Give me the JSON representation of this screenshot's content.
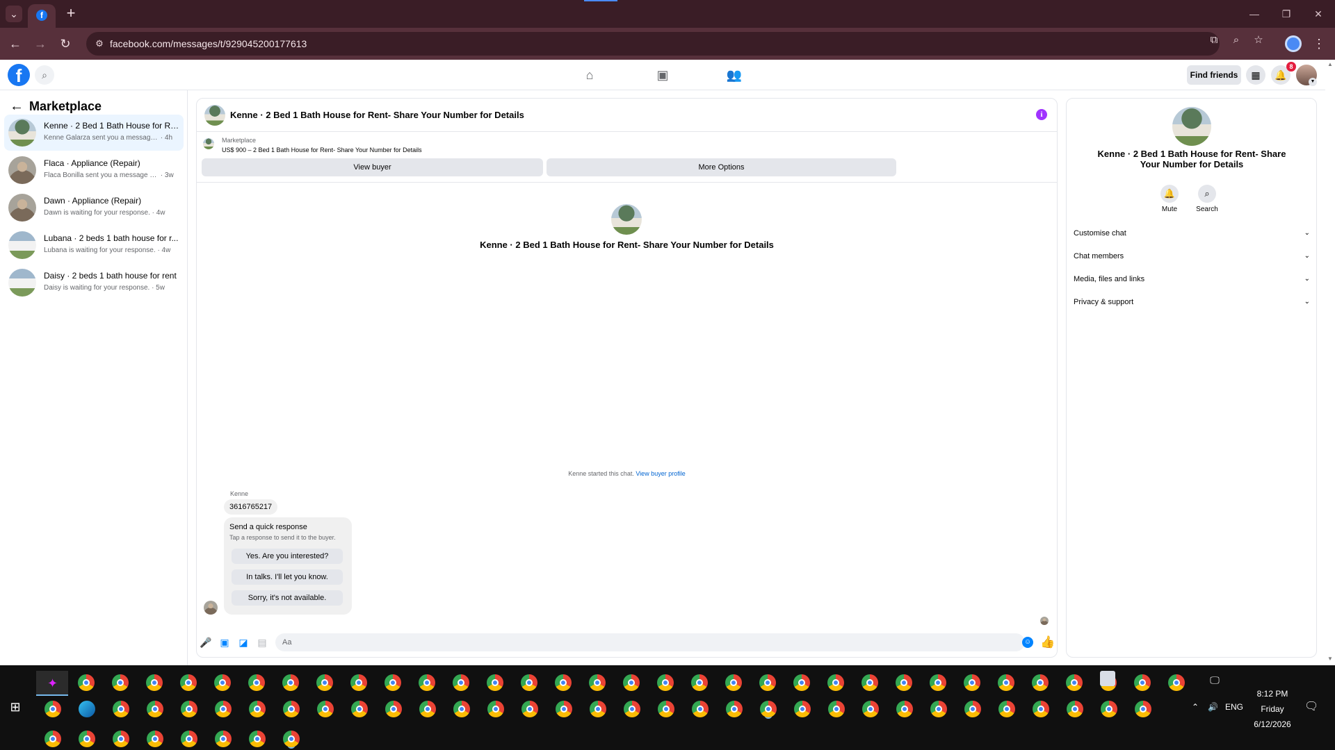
{
  "browser": {
    "url": "facebook.com/messages/t/929045200177613",
    "window_controls": {
      "minimize": "—",
      "restore": "❐",
      "close": "✕"
    }
  },
  "fb_header": {
    "logo": "f",
    "find_friends_label": "Find friends",
    "notification_count": "8"
  },
  "sidebar": {
    "title": "Marketplace",
    "conversations": [
      {
        "name": "Kenne · 2 Bed 1 Bath House for Re...",
        "preview": "Kenne Galarza sent you a message ab...",
        "time": "· 4h",
        "active": true
      },
      {
        "name": "Flaca · Appliance (Repair)",
        "preview": "Flaca Bonilla sent you a message abo...",
        "time": "· 3w"
      },
      {
        "name": "Dawn · Appliance (Repair)",
        "preview": "Dawn is waiting for your response.",
        "time": "· 4w"
      },
      {
        "name": "Lubana · 2 beds 1 bath house for r...",
        "preview": "Lubana is waiting for your response.",
        "time": "· 4w"
      },
      {
        "name": "Daisy · 2 beds 1 bath house for rent",
        "preview": "Daisy is waiting for your response.",
        "time": "· 5w"
      }
    ]
  },
  "chat": {
    "title": "Kenne · 2 Bed 1 Bath House for Rent- Share Your Number for Details",
    "listing_source": "Marketplace",
    "listing_price": "US$ 900 – 2 Bed 1 Bath House for Rent- Share Your Number for Details",
    "view_buyer_label": "View buyer",
    "more_options_label": "More Options",
    "intro_title": "Kenne · 2 Bed 1 Bath House for Rent- Share Your Number for Details",
    "started_text": "Kenne started this chat.",
    "started_link": "View buyer profile",
    "sender_name": "Kenne",
    "message": "3616765217",
    "quick_title": "Send a quick response",
    "quick_subtitle": "Tap a response to send it to the buyer.",
    "quick_responses": [
      "Yes. Are you interested?",
      "In talks. I'll let you know.",
      "Sorry, it's not available."
    ],
    "composer_placeholder": "Aa"
  },
  "info_panel": {
    "title": "Kenne · 2 Bed 1 Bath House for Rent- Share Your Number for Details",
    "mute_label": "Mute",
    "search_label": "Search",
    "sections": [
      "Customise chat",
      "Chat members",
      "Media, files and links",
      "Privacy & support"
    ]
  },
  "taskbar": {
    "language": "ENG",
    "time": "8:12 PM",
    "day": "Friday",
    "date": "6/12/2026"
  },
  "colors": {
    "chrome_dark": "#3a1d26",
    "chrome_toolbar": "#57303b",
    "fb_blue": "#1877f2",
    "messenger_blue": "#0084ff",
    "active_conv": "#ebf5ff",
    "info_purple": "#a033ff"
  }
}
